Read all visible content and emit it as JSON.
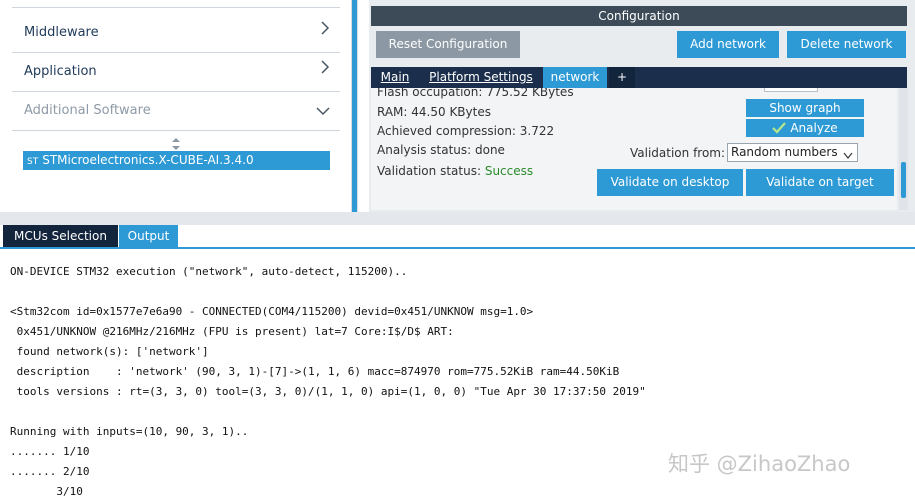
{
  "left_panel": {
    "categories": [
      {
        "label": "Middleware"
      },
      {
        "label": "Application"
      },
      {
        "label": "Additional Software"
      }
    ],
    "selected_pack": "STMicroelectronics.X-CUBE-AI.3.4.0"
  },
  "config": {
    "title": "Configuration",
    "reset_button": "Reset Configuration",
    "add_network_button": "Add network",
    "delete_network_button": "Delete network",
    "tabs": {
      "main": "Main",
      "platform_settings": "Platform Settings",
      "network": "network",
      "plus": "+"
    },
    "info": {
      "flash": "Flash occupation: 775.52 KBytes",
      "ram": "RAM: 44.50 KBytes",
      "compression": "Achieved compression: 3.722",
      "analysis_status": "Analysis status: done",
      "validation_status_label": "Validation status:",
      "validation_status_value": "Success"
    },
    "show_graph_button": "Show graph",
    "analyze_button": "Analyze",
    "validation_from_label": "Validation from:",
    "validation_from_value": "Random numbers",
    "validate_desktop_button": "Validate on desktop",
    "validate_target_button": "Validate on target"
  },
  "bottom_tabs": {
    "mcu_selection": "MCUs Selection",
    "output": "Output"
  },
  "console_lines": [
    "ON-DEVICE STM32 execution (\"network\", auto-detect, 115200)..",
    "<Stm32com id=0x1577e7e6a90 - CONNECTED(COM4/115200) devid=0x451/UNKNOW msg=1.0>",
    " 0x451/UNKNOW @216MHz/216MHz (FPU is present) lat=7 Core:I$/D$ ART:",
    " found network(s): ['network']",
    " description    : 'network' (90, 3, 1)-[7]->(1, 1, 6) macc=874970 rom=775.52KiB ram=44.50KiB",
    " tools versions : rt=(3, 3, 0) tool=(3, 3, 0)/(1, 1, 0) api=(1, 0, 0) \"Tue Apr 30 17:37:50 2019\"",
    "Running with inputs=(10, 90, 3, 1)..",
    "....... 1/10",
    "....... 2/10",
    "       3/10"
  ],
  "watermark": "知乎 @ZihaoZhao",
  "colors": {
    "accent_blue": "#2d9ad6",
    "dark_navy": "#13243d",
    "success_green": "#2a8c2a"
  }
}
